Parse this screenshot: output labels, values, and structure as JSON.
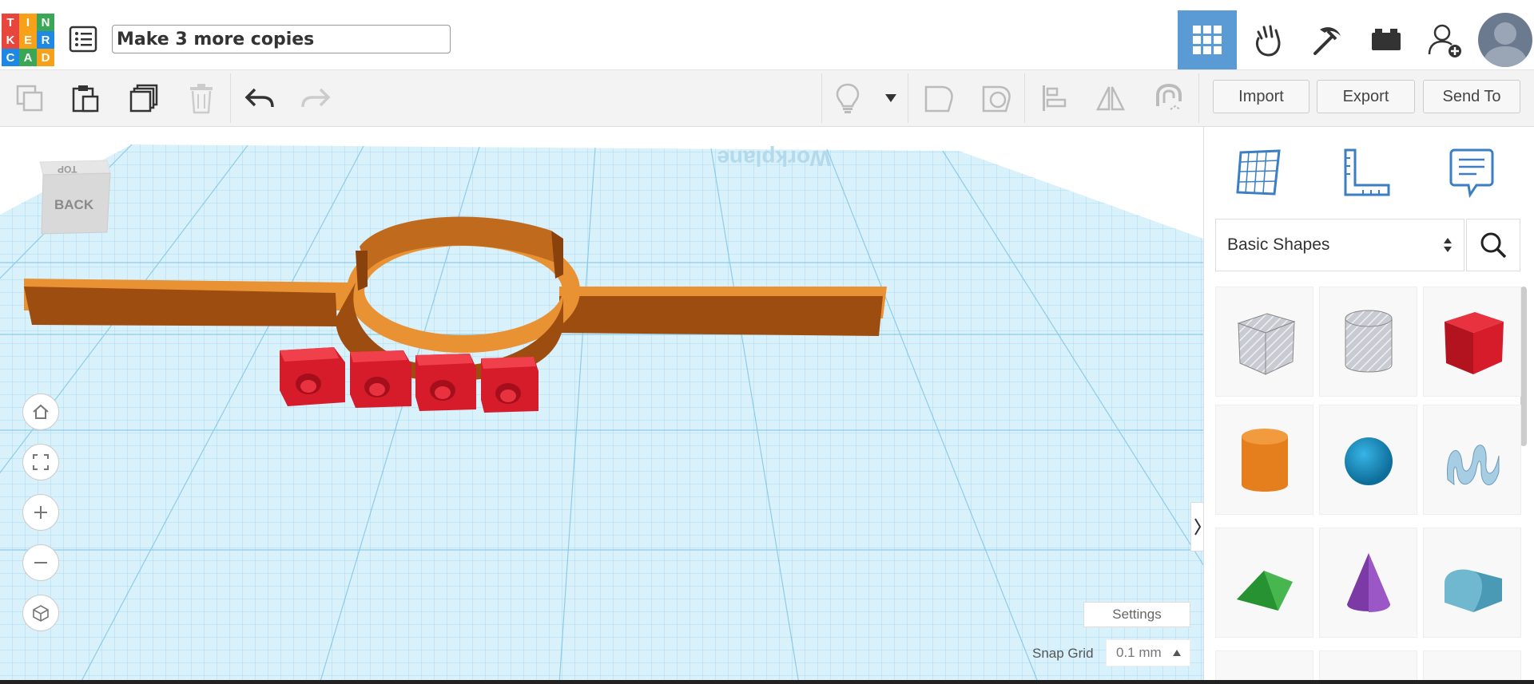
{
  "app": {
    "logo_letters": [
      "T",
      "I",
      "N",
      "K",
      "E",
      "R",
      "C",
      "A",
      "D"
    ],
    "logo_colors": [
      "#e8453c",
      "#f7a11b",
      "#3aa757",
      "#e8453c",
      "#f7a11b",
      "#1e88e5",
      "#1e88e5",
      "#3aa757",
      "#f7a11b"
    ],
    "design_title": "Make 3 more copies"
  },
  "header": {
    "buttons": [
      {
        "name": "grid-view-icon",
        "active": true
      },
      {
        "name": "tinker-hand-icon",
        "active": false
      },
      {
        "name": "pickaxe-icon",
        "active": false
      },
      {
        "name": "bricks-icon",
        "active": false
      },
      {
        "name": "add-user-icon",
        "active": false
      }
    ]
  },
  "toolbar": {
    "left": [
      "copy-icon",
      "paste-icon",
      "duplicate-icon",
      "delete-icon",
      "undo-icon",
      "redo-icon"
    ],
    "right": [
      "bulb-icon",
      "dropdown-caret-icon",
      "shape-outline-icon",
      "hole-outline-icon",
      "align-icon",
      "mirror-icon",
      "magnet-icon"
    ],
    "import_label": "Import",
    "export_label": "Export",
    "send_to_label": "Send To"
  },
  "viewcube": {
    "front_label": "BACK",
    "top_label": "TOP"
  },
  "workplane": {
    "watermark": "Workplane"
  },
  "settings": {
    "settings_label": "Settings",
    "snap_grid_label": "Snap Grid",
    "snap_grid_value": "0.1 mm"
  },
  "panel": {
    "category": "Basic Shapes",
    "tools": [
      "workplane-icon",
      "ruler-icon",
      "notes-icon"
    ],
    "shapes": [
      "box-hole-icon",
      "cylinder-hole-icon",
      "box-icon",
      "cylinder-icon",
      "sphere-icon",
      "scribble-icon",
      "roof-icon",
      "cone-icon",
      "round-roof-icon"
    ]
  },
  "colors": {
    "accent": "#5b9bd5",
    "orange": "#e57e1c",
    "red": "#d61b2a",
    "grid": "#aee0f2"
  }
}
